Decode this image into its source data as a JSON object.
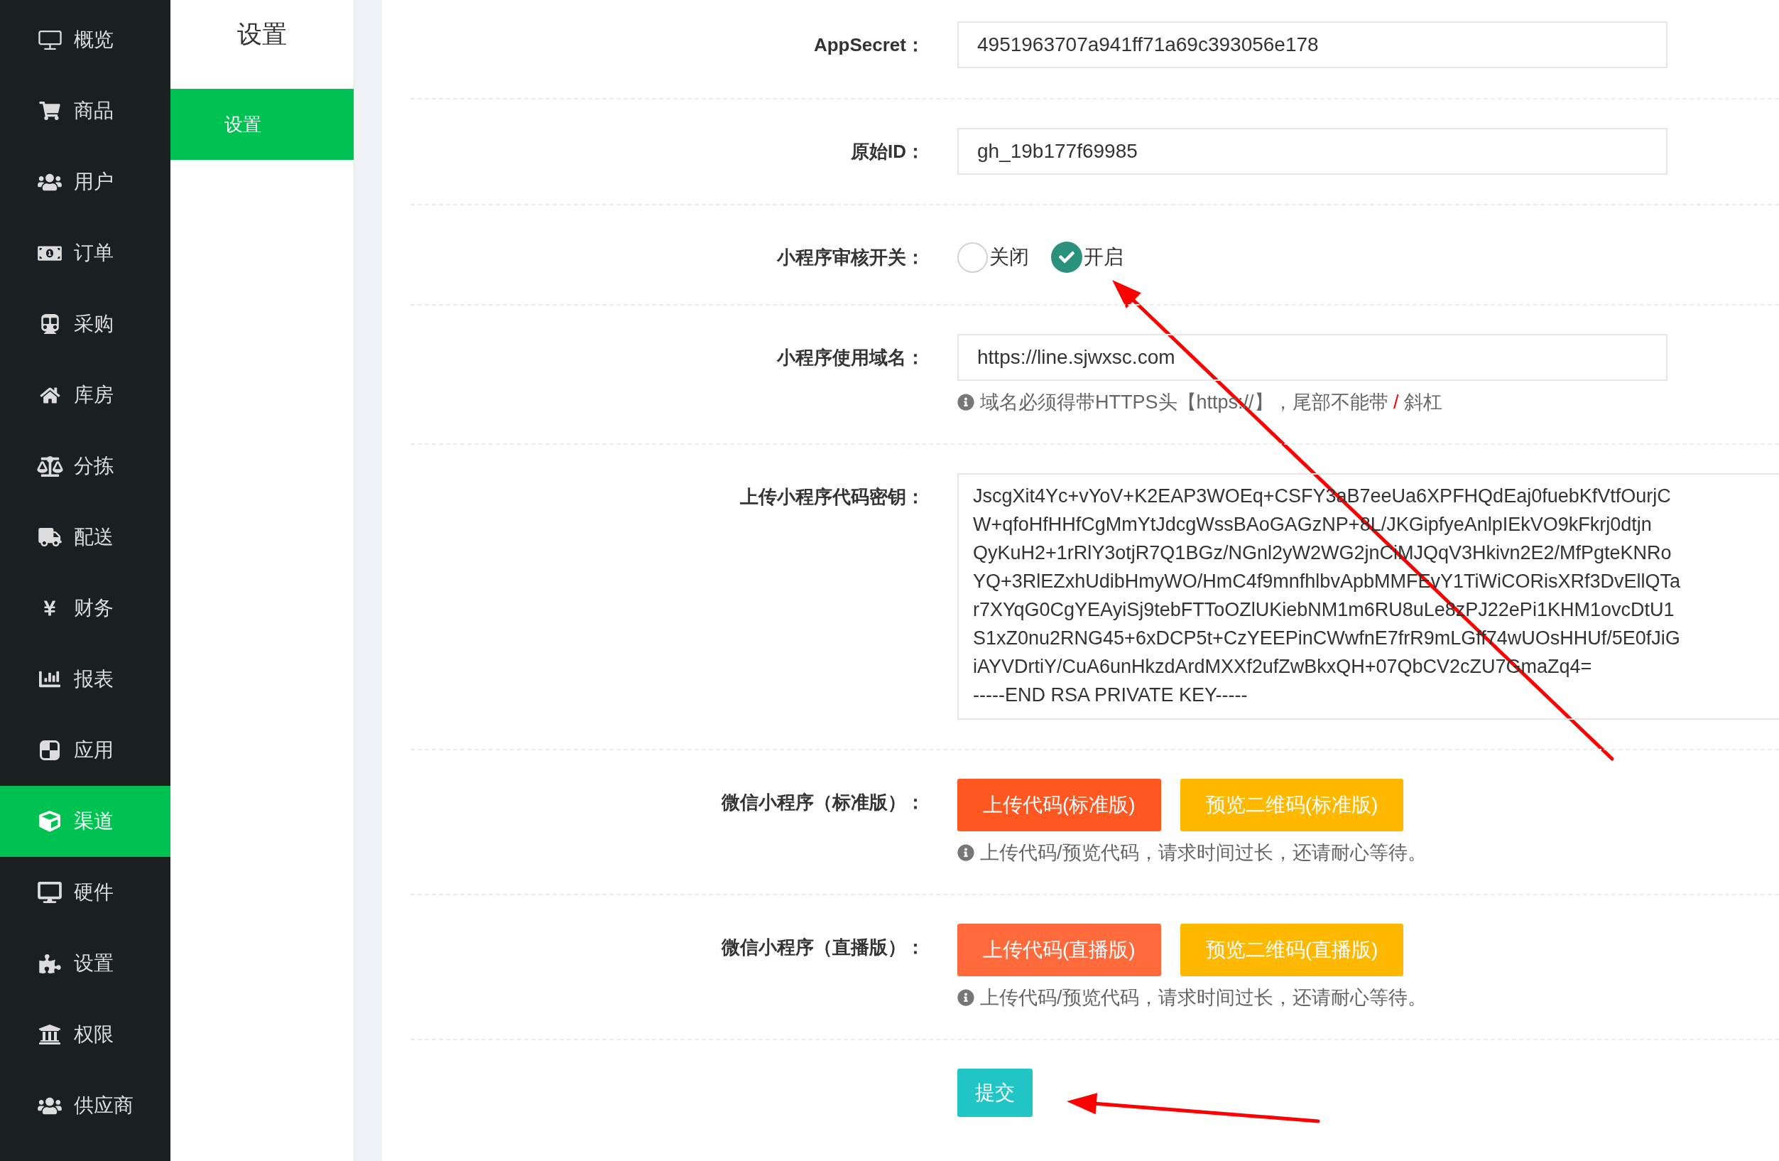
{
  "sidebar": {
    "items": [
      {
        "label": "概览",
        "selected": false
      },
      {
        "label": "商品",
        "selected": false
      },
      {
        "label": "用户",
        "selected": false
      },
      {
        "label": "订单",
        "selected": false
      },
      {
        "label": "采购",
        "selected": false
      },
      {
        "label": "库房",
        "selected": false
      },
      {
        "label": "分拣",
        "selected": false
      },
      {
        "label": "配送",
        "selected": false
      },
      {
        "label": "财务",
        "selected": false
      },
      {
        "label": "报表",
        "selected": false
      },
      {
        "label": "应用",
        "selected": false
      },
      {
        "label": "渠道",
        "selected": true
      },
      {
        "label": "硬件",
        "selected": false
      },
      {
        "label": "设置",
        "selected": false
      },
      {
        "label": "权限",
        "selected": false
      },
      {
        "label": "供应商",
        "selected": false
      }
    ]
  },
  "subnav": {
    "title": "设置",
    "items": [
      {
        "label": "设置",
        "selected": true
      }
    ]
  },
  "form": {
    "rows": [
      {
        "kind": "input",
        "label": "AppSecret：",
        "value": "4951963707a941ff71a69c393056e178"
      },
      {
        "kind": "input",
        "label": "原始ID：",
        "value": "gh_19b177f69985"
      },
      {
        "kind": "radio",
        "label": "小程序审核开关：",
        "options": [
          {
            "label": "关闭",
            "selected": false
          },
          {
            "label": "开启",
            "selected": true
          }
        ]
      },
      {
        "kind": "input",
        "label": "小程序使用域名：",
        "value": "https://line.sjwxsc.com",
        "hint": [
          {
            "text": "域名必须得带HTTPS头【https://】，尾部不能带 ",
            "highlight": false
          },
          {
            "text": "/",
            "highlight": true
          },
          {
            "text": " 斜杠",
            "highlight": false
          }
        ]
      },
      {
        "kind": "textarea",
        "label": "上传小程序代码密钥：",
        "value": "JscgXit4Yc+vYoV+K2EAP3WOEq+CSFY3aB7eeUa6XPFHQdEaj0fuebKfVtfOurjC\nW+qfoHfHHfCgMmYtJdcgWssBAoGAGzNP+8L/JKGipfyeAnlpIEkVO9kFkrj0dtjn\nQyKuH2+1rRlY3otjR7Q1BGz/NGnl2yW2WG2jnCiMJQqV3Hkivn2E2/MfPgteKNRo\nYQ+3RlEZxhUdibHmyWO/HmC4f9mnfhlbvApbMMFEvY1TiWiCORisXRf3DvEllQTa\nr7XYqG0CgYEAyiSj9tebFTToOZlUKiebNM1m6RU8uLe8zPJ22ePi1KHM1ovcDtU1\nS1xZ0nu2RNG45+6xDCP5t+CzYEEPinCWwfnE7frR9mLGff74wUOsHHUf/5E0fJiG\niAYVDrtiY/CuA6unHkzdArdMXXf2ufZwBkxQH+07QbCV2cZU7GmaZq4=\n-----END RSA PRIVATE KEY-----"
      },
      {
        "kind": "buttons",
        "label": "微信小程序（标准版）：",
        "buttons": [
          {
            "label": "上传代码(标准版)",
            "kind": "upload",
            "hovered": false
          },
          {
            "label": "预览二维码(标准版)",
            "kind": "preview",
            "hovered": false
          }
        ],
        "hint": [
          {
            "text": "上传代码/预览代码，请求时间过长，还请耐心等待。",
            "highlight": false
          }
        ]
      },
      {
        "kind": "buttons",
        "label": "微信小程序（直播版）：",
        "buttons": [
          {
            "label": "上传代码(直播版)",
            "kind": "upload",
            "hovered": true
          },
          {
            "label": "预览二维码(直播版)",
            "kind": "preview",
            "hovered": false
          }
        ],
        "hint": [
          {
            "text": "上传代码/预览代码，请求时间过长，还请耐心等待。",
            "highlight": false
          }
        ]
      }
    ],
    "submit": {
      "label": "提交"
    }
  }
}
